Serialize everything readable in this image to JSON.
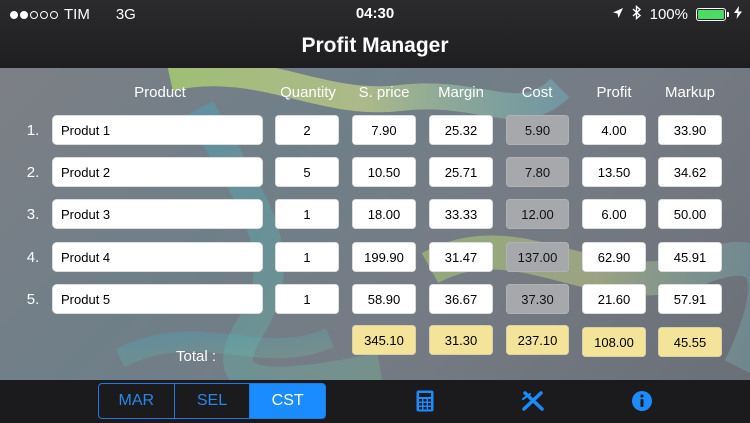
{
  "status_bar": {
    "carrier": "TIM",
    "network": "3G",
    "time": "04:30",
    "battery_percent": "100%",
    "signal_bars_filled": 2,
    "signal_bars_total": 5,
    "icons": [
      "location-arrow-icon",
      "bluetooth-icon",
      "battery-icon",
      "charging-bolt-icon"
    ]
  },
  "nav": {
    "title": "Profit Manager"
  },
  "table": {
    "headers": {
      "product": "Product",
      "quantity": "Quantity",
      "sprice": "S. price",
      "margin": "Margin",
      "cost": "Cost",
      "profit": "Profit",
      "markup": "Markup"
    },
    "rows": [
      {
        "num": "1.",
        "name": "Produt 1",
        "quantity": "2",
        "sprice": "7.90",
        "margin": "25.32",
        "cost": "5.90",
        "profit": "4.00",
        "markup": "33.90"
      },
      {
        "num": "2.",
        "name": "Produt 2",
        "quantity": "5",
        "sprice": "10.50",
        "margin": "25.71",
        "cost": "7.80",
        "profit": "13.50",
        "markup": "34.62"
      },
      {
        "num": "3.",
        "name": "Produt 3",
        "quantity": "1",
        "sprice": "18.00",
        "margin": "33.33",
        "cost": "12.00",
        "profit": "6.00",
        "markup": "50.00"
      },
      {
        "num": "4.",
        "name": "Produt 4",
        "quantity": "1",
        "sprice": "199.90",
        "margin": "31.47",
        "cost": "137.00",
        "profit": "62.90",
        "markup": "45.91"
      },
      {
        "num": "5.",
        "name": "Produt 5",
        "quantity": "1",
        "sprice": "58.90",
        "margin": "36.67",
        "cost": "37.30",
        "profit": "21.60",
        "markup": "57.91"
      }
    ],
    "totals": {
      "label": "Total :",
      "sprice": "345.10",
      "margin": "31.30",
      "cost": "237.10",
      "profit": "108.00",
      "markup": "45.55"
    }
  },
  "toolbar": {
    "segments": [
      "MAR",
      "SEL",
      "CST"
    ],
    "active_segment": "CST",
    "icons": [
      "calculator-icon",
      "clear-icon",
      "info-icon"
    ]
  },
  "colors": {
    "accent": "#1a8cff",
    "cost_cell": "#a7a8ab",
    "total_cell": "#f4e49a",
    "battery": "#4cd964"
  }
}
